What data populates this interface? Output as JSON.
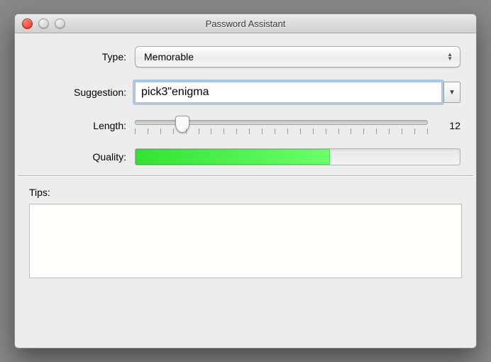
{
  "window": {
    "title": "Password Assistant"
  },
  "labels": {
    "type": "Type:",
    "suggestion": "Suggestion:",
    "length": "Length:",
    "quality": "Quality:",
    "tips": "Tips:"
  },
  "type": {
    "selected": "Memorable"
  },
  "suggestion": {
    "value": "pick3\"enigma"
  },
  "length": {
    "value": "12",
    "min": 8,
    "max": 31,
    "ticks": 24,
    "thumb_percent": 16
  },
  "quality": {
    "percent": 60,
    "fill_color": "#32e332"
  },
  "tips": {
    "text": ""
  }
}
